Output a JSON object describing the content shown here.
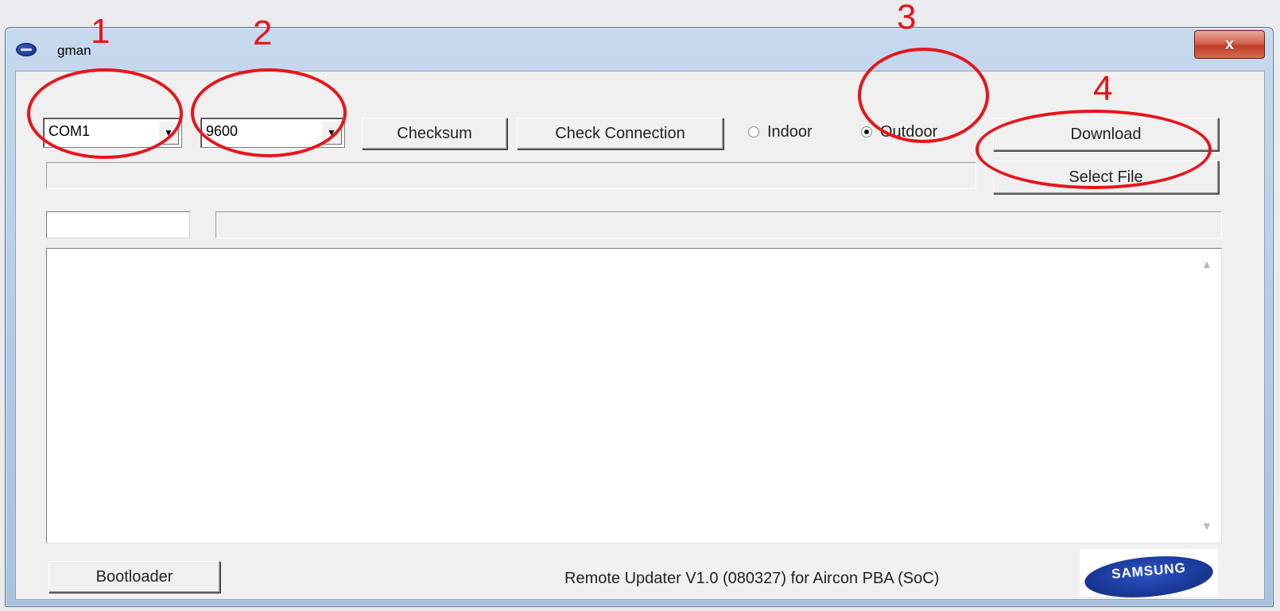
{
  "window": {
    "title": "gman",
    "close_label": "x"
  },
  "toolbar": {
    "port_value": "COM1",
    "baud_value": "9600",
    "checksum_label": "Checksum",
    "check_connection_label": "Check Connection",
    "radio_indoor": "Indoor",
    "radio_outdoor": "Outdoor",
    "selected_mode": "Outdoor",
    "download_label": "Download",
    "select_file_label": "Select File"
  },
  "footer": {
    "bootloader_label": "Bootloader",
    "status_text": "Remote Updater V1.0 (080327) for Aircon PBA (SoC)",
    "logo_text": "SAMSUNG"
  },
  "annotations": {
    "n1": "1",
    "n2": "2",
    "n3": "3",
    "n4": "4"
  },
  "colors": {
    "annotation": "#e8141b",
    "brand_blue": "#1b3a9b"
  }
}
